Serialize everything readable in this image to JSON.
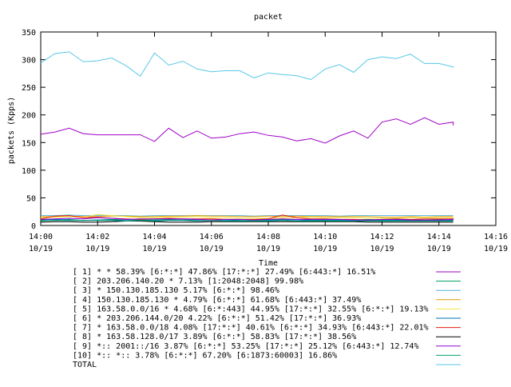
{
  "chart_data": {
    "type": "line",
    "title": "packet",
    "xlabel": "Time",
    "ylabel": "packets (Kpps)",
    "ylim": [
      0,
      350
    ],
    "yticks": [
      0,
      50,
      100,
      150,
      200,
      250,
      300,
      350
    ],
    "xlim": [
      "14:00",
      "14:16"
    ],
    "xticks": [
      {
        "time": "14:00",
        "date": "10/19"
      },
      {
        "time": "14:02",
        "date": "10/19"
      },
      {
        "time": "14:04",
        "date": "10/19"
      },
      {
        "time": "14:06",
        "date": "10/19"
      },
      {
        "time": "14:08",
        "date": "10/19"
      },
      {
        "time": "14:10",
        "date": "10/19"
      },
      {
        "time": "14:12",
        "date": "10/19"
      },
      {
        "time": "14:14",
        "date": "10/19"
      },
      {
        "time": "14:16",
        "date": "10/19"
      }
    ],
    "x": [
      "14:00:00",
      "14:00:30",
      "14:01:00",
      "14:01:30",
      "14:02:00",
      "14:02:30",
      "14:03:00",
      "14:03:30",
      "14:04:00",
      "14:04:30",
      "14:05:00",
      "14:05:30",
      "14:06:00",
      "14:06:30",
      "14:07:00",
      "14:07:30",
      "14:08:00",
      "14:08:30",
      "14:09:00",
      "14:09:30",
      "14:10:00",
      "14:10:30",
      "14:11:00",
      "14:11:30",
      "14:12:00",
      "14:12:30",
      "14:13:00",
      "14:13:30",
      "14:14:00",
      "14:14:30"
    ],
    "grid": false,
    "legend_position": "bottom",
    "series": [
      {
        "name": "[ 1] * * 58.39%  [6:*:*] 47.86% [17:*:*] 27.49% [6:443:*] 16.51%",
        "color": "#a000c8",
        "values": [
          165,
          169,
          176,
          166,
          164,
          164,
          164,
          164,
          152,
          176,
          159,
          171,
          158,
          160,
          166,
          169,
          163,
          160,
          153,
          157,
          149,
          162,
          171,
          158,
          187,
          193,
          183,
          195,
          183,
          187,
          181
        ]
      },
      {
        "name": "[ 2] 203.206.140.20 * 7.13%  [1:2048:2048] 99.98%",
        "color": "#00a060",
        "values": [
          8,
          10,
          11,
          9,
          10,
          11,
          11,
          10,
          10,
          11,
          10,
          11,
          10,
          10,
          9,
          9,
          10,
          11,
          10,
          10,
          10,
          10,
          10,
          11,
          10,
          10,
          10,
          10,
          11,
          10,
          10
        ]
      },
      {
        "name": "[ 3] * 150.130.185.130 5.17%  [6:*:*] 98.46%",
        "color": "#56b4e9",
        "values": [
          18,
          18,
          19,
          18,
          18,
          18,
          18,
          17,
          18,
          18,
          18,
          18,
          18,
          18,
          18,
          17,
          18,
          18,
          18,
          18,
          18,
          17,
          18,
          18,
          18,
          18,
          18,
          18,
          18,
          18,
          18
        ]
      },
      {
        "name": "[ 4] 150.130.185.130 * 4.79%  [6:*:*] 61.68% [6:443:*] 37.49%",
        "color": "#e69f00",
        "values": [
          16,
          16,
          17,
          16,
          16,
          17,
          17,
          16,
          16,
          17,
          17,
          18,
          17,
          17,
          16,
          16,
          17,
          16,
          17,
          16,
          16,
          16,
          16,
          16,
          15,
          15,
          16,
          15,
          16,
          16,
          16
        ]
      },
      {
        "name": "[ 5] 163.58.0.0/16 * 4.68%  [6:*:443] 44.95% [17:*:*] 32.55% [6:*:*] 19.13%",
        "color": "#f0e442",
        "values": [
          14,
          15,
          16,
          15,
          20,
          18,
          16,
          14,
          14,
          15,
          15,
          16,
          14,
          14,
          13,
          13,
          13,
          14,
          14,
          15,
          14,
          14,
          14,
          13,
          13,
          13,
          14,
          14,
          14,
          14,
          13
        ]
      },
      {
        "name": "[ 6] * 203.206.144.0/20 4.22%  [6:*:*] 51.42% [17:*:*] 36.93%",
        "color": "#0072b2",
        "values": [
          10,
          11,
          10,
          9,
          10,
          10,
          9,
          9,
          9,
          10,
          10,
          9,
          9,
          10,
          9,
          8,
          9,
          10,
          10,
          9,
          9,
          9,
          9,
          9,
          9,
          9,
          9,
          9,
          9,
          9,
          9
        ]
      },
      {
        "name": "[ 7] * 163.58.0.0/18 4.08%  [17:*:*] 40.61% [6:*:*] 34.93% [6:443:*] 22.01%",
        "color": "#e51e10",
        "values": [
          12,
          17,
          18,
          14,
          15,
          13,
          12,
          11,
          12,
          13,
          12,
          12,
          12,
          11,
          11,
          11,
          12,
          19,
          14,
          12,
          12,
          11,
          11,
          10,
          11,
          12,
          11,
          12,
          12,
          12,
          11
        ]
      },
      {
        "name": "[ 8] * 163.58.128.0/17 3.89%  [6:*:*] 58.83% [17:*:*] 38.56%",
        "color": "#000000",
        "values": [
          6,
          7,
          7,
          6,
          6,
          7,
          8,
          8,
          7,
          6,
          6,
          6,
          7,
          7,
          7,
          7,
          7,
          7,
          7,
          7,
          7,
          7,
          7,
          6,
          6,
          6,
          6,
          6,
          6,
          6,
          6
        ]
      },
      {
        "name": "[ 9] *:: 2001::/16 3.87%  [6:*:*] 53.25% [17:*:*] 25.12% [6:443:*] 12.74%",
        "color": "#9400d3",
        "values": [
          11,
          12,
          13,
          12,
          14,
          13,
          11,
          12,
          12,
          12,
          12,
          11,
          10,
          11,
          11,
          10,
          11,
          12,
          11,
          11,
          11,
          11,
          10,
          10,
          11,
          11,
          10,
          10,
          10,
          11,
          10
        ]
      },
      {
        "name": "[10] *:: *:: 3.78%  [6:*:*] 67.20% [6:1873:60003] 16.86%",
        "color": "#009e73",
        "values": [
          9,
          9,
          9,
          9,
          9,
          9,
          8,
          9,
          8,
          9,
          9,
          8,
          9,
          8,
          8,
          8,
          8,
          9,
          8,
          8,
          8,
          8,
          8,
          8,
          8,
          8,
          8,
          8,
          8,
          8,
          8
        ]
      },
      {
        "name": "TOTAL",
        "color": "#56c8e8",
        "values": [
          294,
          311,
          314,
          296,
          298,
          303,
          289,
          270,
          312,
          290,
          297,
          283,
          278,
          280,
          280,
          267,
          276,
          273,
          271,
          264,
          283,
          291,
          277,
          300,
          305,
          302,
          310,
          293,
          293,
          287,
          285
        ]
      }
    ]
  }
}
